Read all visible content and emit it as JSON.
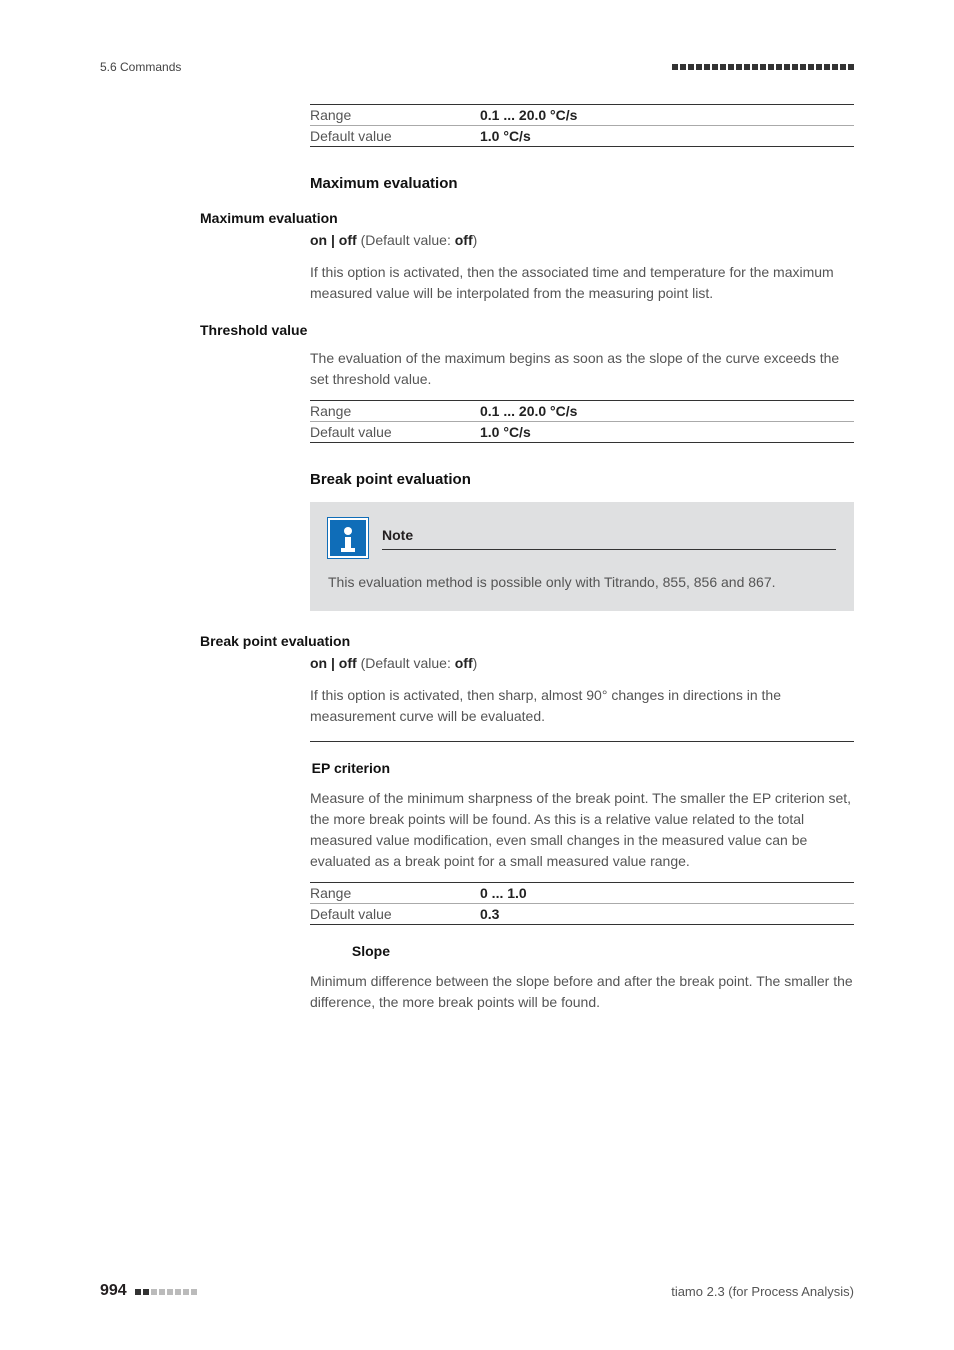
{
  "header": {
    "section": "5.6 Commands"
  },
  "spec1": {
    "rangeLabel": "Range",
    "rangeValue": "0.1 ... 20.0 °C/s",
    "defaultLabel": "Default value",
    "defaultValue": "1.0 °C/s"
  },
  "maxEval": {
    "title": "Maximum evaluation",
    "sideLabel": "Maximum evaluation",
    "onOffBold1": "on | off",
    "onOffLight1": " (Default value: ",
    "onOffBold2": "off",
    "onOffLight2": ")",
    "desc": "If this option is activated, then the associated time and temperature for the maximum measured value will be interpolated from the measuring point list."
  },
  "threshold": {
    "sideLabel": "Threshold value",
    "desc": "The evaluation of the maximum begins as soon as the slope of the curve exceeds the set threshold value.",
    "rangeLabel": "Range",
    "rangeValue": "0.1 ... 20.0 °C/s",
    "defaultLabel": "Default value",
    "defaultValue": "1.0 °C/s"
  },
  "breakPoint": {
    "title": "Break point evaluation",
    "noteTitle": "Note",
    "noteBody": "This evaluation method is possible only with Titrando, 855, 856 and 867.",
    "sideLabel": "Break point evaluation",
    "onOffBold1": "on | off",
    "onOffLight1": " (Default value: ",
    "onOffBold2": "off",
    "onOffLight2": ")",
    "desc": "If this option is activated, then sharp, almost 90° changes in directions in the measurement curve will be evaluated."
  },
  "epCriterion": {
    "sideLabel": "EP criterion",
    "desc": "Measure of the minimum sharpness of the break point. The smaller the EP criterion set, the more break points will be found. As this is a relative value related to the total measured value modification, even small changes in the measured value can be evaluated as a break point for a small measured value range.",
    "rangeLabel": "Range",
    "rangeValue": "0 ... 1.0",
    "defaultLabel": "Default value",
    "defaultValue": "0.3"
  },
  "slope": {
    "sideLabel": "Slope",
    "desc": "Minimum difference between the slope before and after the break point. The smaller the difference, the more break points will be found."
  },
  "footer": {
    "pageNum": "994",
    "right": "tiamo 2.3 (for Process Analysis)"
  }
}
